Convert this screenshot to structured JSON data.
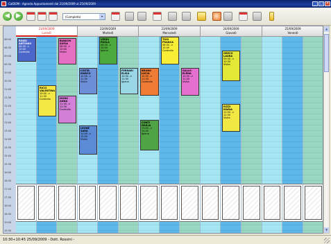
{
  "window": {
    "title": "CalDOM - Agenda Appuntamenti dal 21/09/2009 al 25/09/2009",
    "buttons": [
      "_",
      "□",
      "X"
    ]
  },
  "toolbar": {
    "view_select": "(Completa)",
    "view_arrow": "▾",
    "back_glyph": "◀",
    "fwd_glyph": "▶"
  },
  "days": [
    {
      "date": "21/09/2009",
      "name": "Lunedì",
      "today": true
    },
    {
      "date": "22/09/2009",
      "name": "Martedì",
      "today": false
    },
    {
      "date": "23/09/2009",
      "name": "Mercoledì",
      "today": false
    },
    {
      "date": "24/09/2009",
      "name": "Giovedì",
      "today": false
    },
    {
      "date": "25/09/2009",
      "name": "Venerdì",
      "today": false
    }
  ],
  "times": [
    "08:00",
    "08:30",
    "09:00",
    "09:30",
    "10:00",
    "10:30",
    "11:00",
    "11:30",
    "12:00",
    "12:30",
    "13:00",
    "13:30",
    "14:00",
    "14:30",
    "15:00",
    "15:30",
    "16:00",
    "16:30",
    "17:00",
    "17:30",
    "18:00",
    "18:30",
    "19:00",
    "19:30"
  ],
  "appointments": [
    {
      "name": "ROSSI ANTONIO",
      "detail": "08:30 -> 10:00",
      "extra": "Controllo",
      "color": "#4b67c9"
    },
    {
      "name": "BIANCHI SOFIA",
      "detail": "08:30 -> 10:00",
      "extra": "Visita",
      "color": "#e56fc3"
    },
    {
      "name": "VERDI PAOLA",
      "detail": "08:30 -> 10:00",
      "extra": "Igiene",
      "color": "#4caa3c"
    },
    {
      "name": "TOSI FRANCA",
      "detail": "08:30 -> 10:00",
      "extra": "Controllo",
      "color": "#f7ee35"
    },
    {
      "name": "GRECO LAURA",
      "detail": "09:30 -> 10:30",
      "extra": "Visita",
      "color": "#e3e837"
    },
    {
      "name": "RICCI VALENTINA",
      "detail": "10:00 -> 11:30",
      "extra": "Controllo",
      "color": "#f4e845"
    },
    {
      "name": "COSTA MARCO",
      "detail": "10:30 -> 11:30",
      "extra": "Visita",
      "color": "#6d8fd8"
    },
    {
      "name": "FERRARI ELISA",
      "detail": "10:30 -> 11:30",
      "extra": "Igiene",
      "color": "#9ad6e6"
    },
    {
      "name": "BRUNO LUCIA",
      "detail": "10:30 -> 11:30",
      "extra": "Controllo",
      "color": "#f07b35"
    },
    {
      "name": "GALLO ELENA",
      "detail": "10:30 -> 11:30",
      "extra": "Visita",
      "color": "#e46fce"
    },
    {
      "name": "MORO ANNA",
      "detail": "11:30 -> 12:30",
      "extra": "Controllo",
      "color": "#d47fd8"
    },
    {
      "name": "RIZZI MARIA",
      "detail": "12:00 -> 12:30",
      "extra": "Visita",
      "color": "#f2e844"
    },
    {
      "name": "CONTI GIULIA",
      "detail": "13:00 -> 14:00",
      "extra": "Igiene",
      "color": "#4fa344"
    },
    {
      "name": "LEONE SARA",
      "detail": "14:00 -> 15:00",
      "extra": "Visita",
      "color": "#5b8bd6"
    }
  ],
  "status": {
    "text": "10:30÷10:45 25/09/2009 - Dott. Rossini -"
  }
}
